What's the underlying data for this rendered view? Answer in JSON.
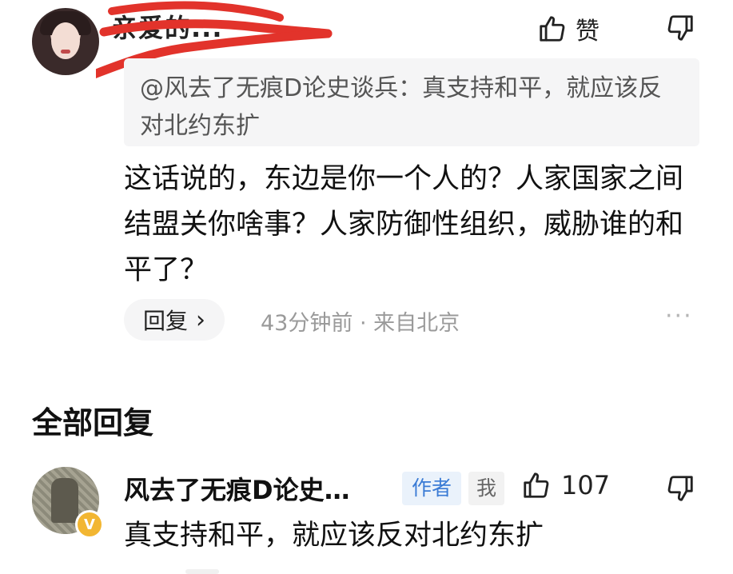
{
  "comment": {
    "username": "亲爱的...",
    "like_label": "赞",
    "quote": "@风去了无痕D论史谈兵：真支持和平，就应该反对北约东扩",
    "body": "这话说的，东边是你一个人的？人家国家之间结盟关你啥事？人家防御性组织，威胁谁的和平了？",
    "reply_label": "回复",
    "reply_chevron": "›",
    "meta": "43分钟前 · 来自北京",
    "more": "···",
    "icons": [
      "avatar",
      "thumbs-up-icon",
      "thumbs-down-icon",
      "more-icon",
      "chevron-right-icon"
    ]
  },
  "section": {
    "title": "全部回复"
  },
  "reply": {
    "username": "风去了无痕D论史…",
    "badge": "V",
    "tag_author": "作者",
    "tag_me": "我",
    "likes": "107",
    "body": "真支持和平，就应该反对北约东扩"
  },
  "colors": {
    "scribble": "#e2332b",
    "quote_bg": "#f5f5f6",
    "meta_text": "#9a9a9a",
    "author_tag_text": "#3a7bd5",
    "author_tag_bg": "#eaf2fb",
    "verify_badge": "#f2b632"
  }
}
